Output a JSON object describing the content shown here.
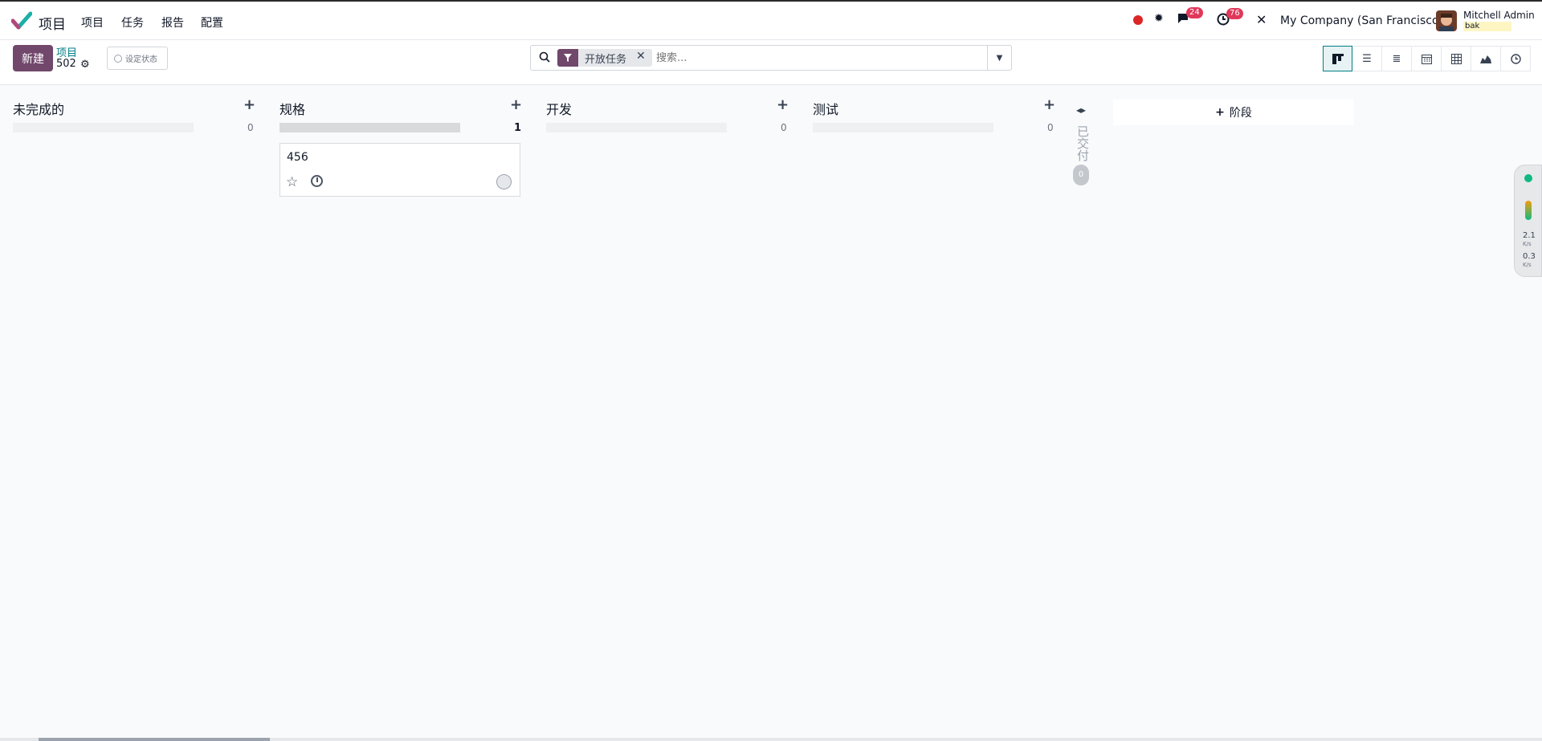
{
  "app": {
    "title": "项目",
    "accent": "#71476b",
    "teal": "#017e84"
  },
  "nav": {
    "menu": [
      "项目",
      "任务",
      "报告",
      "配置"
    ]
  },
  "systray": {
    "messages_count": "24",
    "activities_count": "76",
    "company": "My Company (San Francisco)",
    "user_name": "Mitchell Admin",
    "db_name": "bak"
  },
  "control": {
    "new_label": "新建",
    "breadcrumb": "项目",
    "record_count": "502",
    "status_label": "设定状态"
  },
  "search": {
    "facet": "开放任务",
    "placeholder": "搜索..."
  },
  "views": [
    "kanban",
    "list",
    "activity",
    "calendar",
    "pivot",
    "graph",
    "timeline"
  ],
  "columns": [
    {
      "title": "未完成的",
      "count": "0"
    },
    {
      "title": "规格",
      "count": "1"
    },
    {
      "title": "开发",
      "count": "0"
    },
    {
      "title": "测试",
      "count": "0"
    }
  ],
  "card": {
    "title": "456"
  },
  "folded_column": {
    "title": "已交付",
    "count": "0"
  },
  "add_stage_label": "阶段",
  "network_meter": {
    "down": "2.1",
    "up": "0.3",
    "unit": "K/s"
  }
}
